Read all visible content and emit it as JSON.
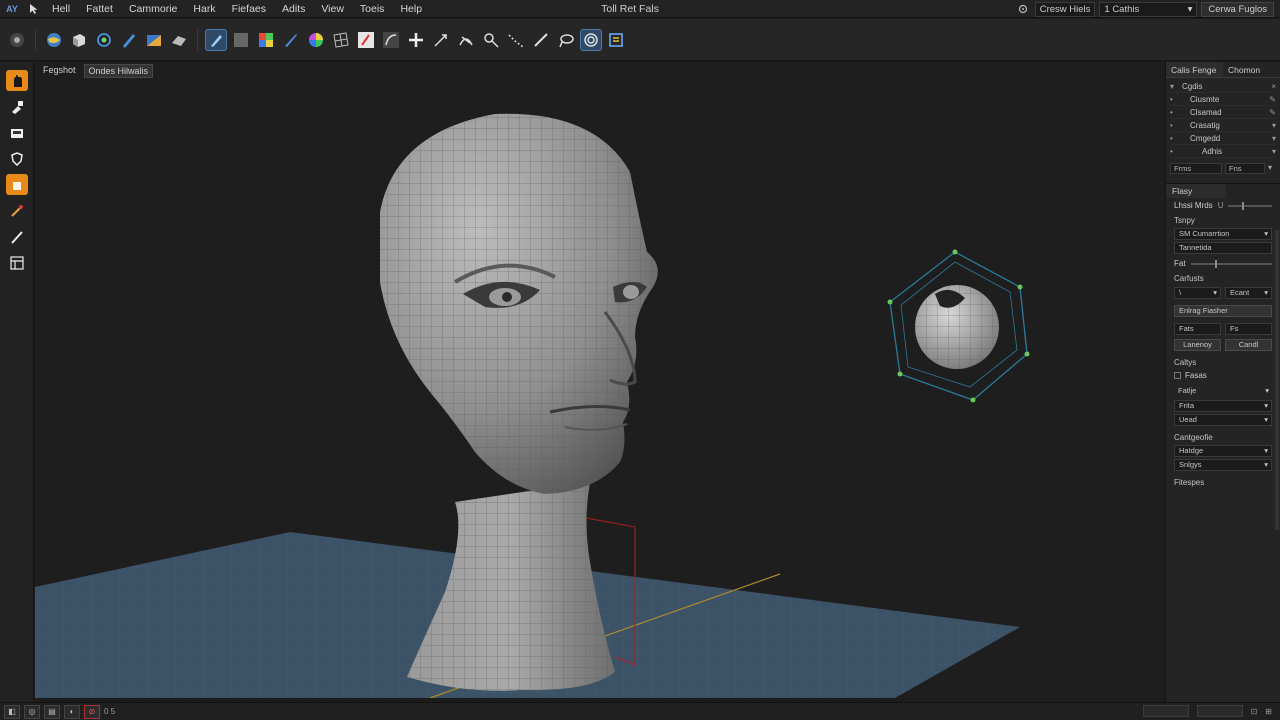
{
  "menubar": {
    "logo": "AY",
    "items": [
      "Hell",
      "Fattet",
      "Cammorie",
      "Hark",
      "Fiefaes",
      "Adits",
      "View",
      "Toeis",
      "Help"
    ],
    "title": "Toll Ret Fals",
    "field_label": "Cresw Hiels",
    "select_value": "1 Cathis",
    "button_label": "Cerwa Fuglos"
  },
  "viewport": {
    "tabs": [
      "Fegshot",
      "Ondes Hilwalis"
    ]
  },
  "right_panel": {
    "tabs": [
      "Calis Fenge",
      "Chomon"
    ],
    "outliner": [
      {
        "label": "Cgdis"
      },
      {
        "label": "Ciusmte"
      },
      {
        "label": "Clsamad"
      },
      {
        "label": "Crasatig"
      },
      {
        "label": "Cmgedd"
      },
      {
        "label": "Adhis"
      }
    ],
    "mini_fields": [
      "Frms",
      "Fns"
    ],
    "props_header": "Flasy",
    "props": {
      "slider_label": "Lhssi Mrds",
      "slider_suffix": "U",
      "type_label": "Tsnpy",
      "type_value": "SM Cumarrtion",
      "sub_value": "Tannetida",
      "field_label": "Fat",
      "controls_label": "Carfusts",
      "controls_a": "\\",
      "controls_b": "Ecant",
      "section_btn": "Enlrag Fiasher",
      "row1_a": "Fats",
      "row1_b": "Fs",
      "row2_a": "Lanenoy",
      "row2_b": "Candl",
      "check_group": "Caltys",
      "check_label": "Fasas",
      "pulse_label": "Fatlje",
      "pulse_v1": "Frita",
      "pulse_v2": "Uead",
      "config_label": "Cantgeofie",
      "config_v1": "Hatdge",
      "config_v2": "Snlgys",
      "footer_label": "Fitespes"
    }
  },
  "statusbar": {
    "text": "0 5"
  },
  "colors": {
    "accent_orange": "#e88a1a",
    "selection_blue": "#2f4a66",
    "grid_floor": "#3c5266"
  }
}
